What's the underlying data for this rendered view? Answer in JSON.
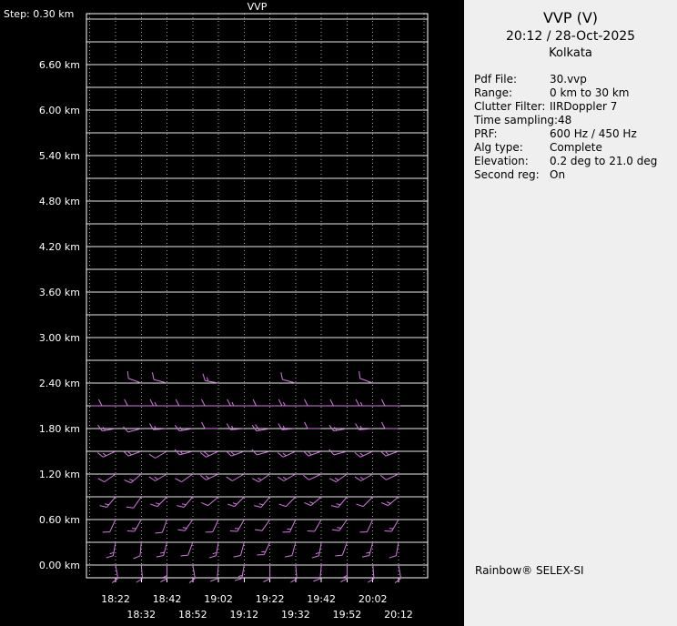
{
  "chart": {
    "title": "VVP",
    "step_label": "Step: 0.30 km"
  },
  "chart_data": {
    "type": "scatter",
    "subtype": "wind-barb time-height profile",
    "title": "VVP",
    "x": [
      "18:22",
      "18:32",
      "18:42",
      "18:52",
      "19:02",
      "19:12",
      "19:22",
      "19:32",
      "19:42",
      "19:52",
      "20:02",
      "20:12"
    ],
    "ylim": [
      0,
      7.2
    ],
    "y_step_km": 0.3,
    "grid": "on",
    "y_ticks": [
      {
        "km": 6.6,
        "label": "6.60 km"
      },
      {
        "km": 6.0,
        "label": "6.00 km"
      },
      {
        "km": 5.4,
        "label": "5.40 km"
      },
      {
        "km": 4.8,
        "label": "4.80 km"
      },
      {
        "km": 4.2,
        "label": "4.20 km"
      },
      {
        "km": 3.6,
        "label": "3.60 km"
      },
      {
        "km": 3.0,
        "label": "3.00 km"
      },
      {
        "km": 2.4,
        "label": "2.40 km"
      },
      {
        "km": 1.8,
        "label": "1.80 km"
      },
      {
        "km": 1.2,
        "label": "1.20 km"
      },
      {
        "km": 0.6,
        "label": "0.60 km"
      },
      {
        "km": 0.0,
        "label": "0.00 km"
      }
    ],
    "reg_line_km": 2.1,
    "series": [
      {
        "height_km": 0.0,
        "dir_deg": [
          170,
          175,
          180,
          170,
          185,
          190,
          180,
          175,
          185,
          180,
          175,
          170
        ],
        "speed_kt": [
          10,
          10,
          15,
          10,
          10,
          15,
          10,
          10,
          10,
          15,
          10,
          10
        ]
      },
      {
        "height_km": 0.3,
        "dir_deg": [
          190,
          185,
          195,
          200,
          190,
          195,
          205,
          195,
          190,
          200,
          195,
          190
        ],
        "speed_kt": [
          15,
          10,
          15,
          10,
          15,
          10,
          15,
          10,
          15,
          10,
          15,
          10
        ]
      },
      {
        "height_km": 0.6,
        "dir_deg": [
          205,
          210,
          200,
          215,
          205,
          210,
          215,
          205,
          210,
          215,
          205,
          210
        ],
        "speed_kt": [
          10,
          15,
          10,
          15,
          10,
          15,
          10,
          15,
          10,
          15,
          10,
          15
        ]
      },
      {
        "height_km": 0.9,
        "dir_deg": [
          220,
          215,
          225,
          220,
          230,
          225,
          220,
          225,
          230,
          220,
          225,
          230
        ],
        "speed_kt": [
          15,
          10,
          15,
          15,
          10,
          15,
          15,
          10,
          15,
          15,
          10,
          15
        ]
      },
      {
        "height_km": 1.2,
        "dir_deg": [
          235,
          230,
          240,
          235,
          245,
          240,
          235,
          240,
          245,
          235,
          240,
          245
        ],
        "speed_kt": [
          10,
          15,
          15,
          10,
          15,
          10,
          15,
          15,
          10,
          15,
          15,
          10
        ]
      },
      {
        "height_km": 1.5,
        "dir_deg": [
          245,
          250,
          240,
          255,
          245,
          250,
          255,
          245,
          250,
          255,
          245,
          250
        ],
        "speed_kt": [
          15,
          15,
          10,
          15,
          20,
          15,
          10,
          15,
          15,
          10,
          15,
          15
        ]
      },
      {
        "height_km": 1.8,
        "dir_deg": [
          260,
          255,
          265,
          260,
          270,
          265,
          260,
          265,
          270,
          260,
          265,
          270
        ],
        "speed_kt": [
          15,
          10,
          15,
          15,
          10,
          15,
          20,
          15,
          10,
          15,
          15,
          10
        ]
      },
      {
        "height_km": 2.1,
        "dir_deg": [
          270,
          270,
          270,
          270,
          270,
          270,
          270,
          270,
          270,
          270,
          270,
          270
        ],
        "speed_kt": [
          10,
          10,
          15,
          10,
          10,
          15,
          10,
          15,
          10,
          10,
          15,
          10
        ]
      },
      {
        "height_km": 2.4,
        "dir_deg": [
          null,
          290,
          285,
          null,
          280,
          null,
          null,
          285,
          null,
          null,
          290,
          null
        ],
        "speed_kt": [
          null,
          10,
          10,
          null,
          15,
          null,
          null,
          10,
          null,
          null,
          10,
          null
        ]
      }
    ]
  },
  "panel": {
    "title": "VVP (V)",
    "datetime": "20:12 / 28-Oct-2025",
    "site": "Kolkata",
    "fields": [
      {
        "key": "Pdf File:",
        "value": "30.vvp"
      },
      {
        "key": "Range:",
        "value": "0 km to 30 km"
      },
      {
        "key": "Clutter Filter:",
        "value": "IIRDoppler 7"
      },
      {
        "key": "Time sampling:",
        "value": "48"
      },
      {
        "key": "PRF:",
        "value": "600 Hz / 450 Hz"
      },
      {
        "key": "Alg type:",
        "value": "Complete"
      },
      {
        "key": "Elevation:",
        "value": "0.2 deg to 21.0 deg"
      },
      {
        "key": "Second reg:",
        "value": "On"
      }
    ],
    "brand": "Rainbow® SELEX-SI"
  },
  "colors": {
    "background": "#000000",
    "panel_bg": "#efefef",
    "chart_text": "#ffffff",
    "panel_text": "#000000",
    "grid_h": "#e8e8e8",
    "grid_v": "#aaaaaa",
    "border": "#ffffff",
    "barb": "#d478e2"
  }
}
